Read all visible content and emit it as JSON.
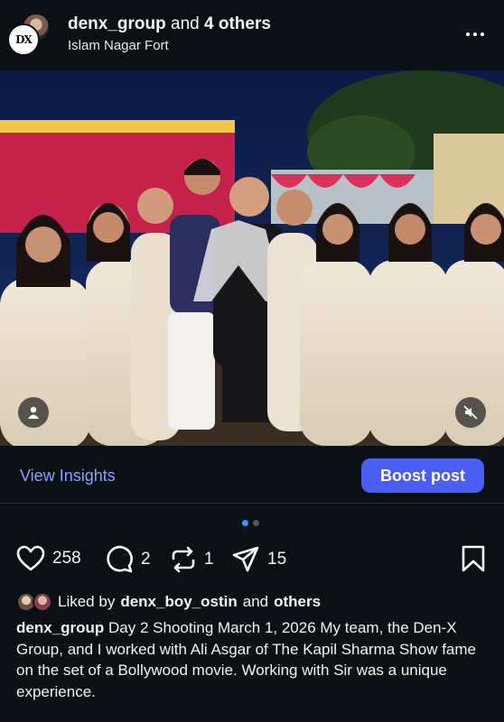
{
  "header": {
    "username": "denx_group",
    "connector": "and",
    "others": "4 others",
    "location": "Islam Nagar Fort",
    "logo_text": "DX",
    "more_icon": "more-horizontal-icon"
  },
  "photo": {
    "user_tag_icon": "person-icon",
    "mute_icon": "speaker-muted-icon"
  },
  "insights": {
    "view_label": "View Insights",
    "boost_label": "Boost post",
    "accent": "#4a5ef5",
    "link_color": "#8aa2ff"
  },
  "carousel": {
    "current": 1,
    "total": 2
  },
  "actions": {
    "likes": "258",
    "comments": "2",
    "reposts": "1",
    "shares": "15"
  },
  "liked_by": {
    "prefix": "Liked by",
    "user": "denx_boy_ostin",
    "and": "and",
    "others": "others"
  },
  "caption": {
    "username": "denx_group",
    "text": "Day 2 Shooting March 1, 2026 My team, the Den-X Group, and I worked with Ali Asgar of The Kapil Sharma Show fame on the set of a Bollywood movie. Working with Sir was a unique experience."
  }
}
